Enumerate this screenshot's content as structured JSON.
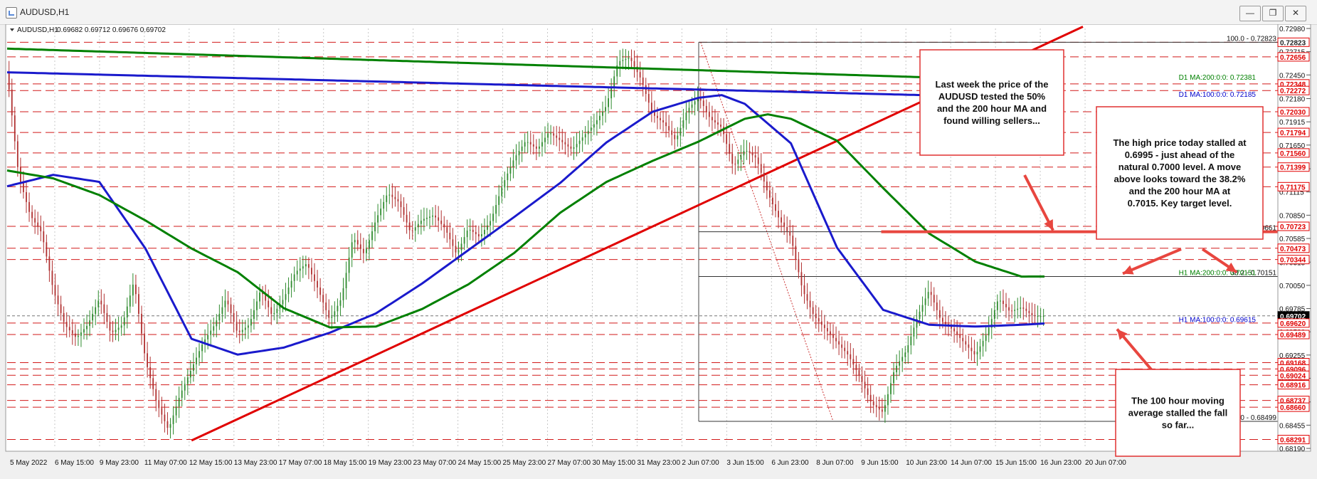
{
  "window": {
    "title": "AUDUSD,H1",
    "minimize": "—",
    "restore": "❐",
    "close": "✕"
  },
  "header": {
    "symbol": "AUDUSD,H1",
    "ohlc": "0.69682 0.69712 0.69676 0.69702"
  },
  "chart_data": {
    "type": "line",
    "symbol": "AUDUSD",
    "timeframe": "H1",
    "x_ticks": [
      "5 May 2022",
      "6 May 15:00",
      "9 May 23:00",
      "11 May 07:00",
      "12 May 15:00",
      "13 May 23:00",
      "17 May 07:00",
      "18 May 15:00",
      "19 May 23:00",
      "23 May 07:00",
      "24 May 15:00",
      "25 May 23:00",
      "27 May 07:00",
      "30 May 15:00",
      "31 May 23:00",
      "2 Jun 07:00",
      "3 Jun 15:00",
      "6 Jun 23:00",
      "8 Jun 07:00",
      "9 Jun 15:00",
      "10 Jun 23:00",
      "14 Jun 07:00",
      "15 Jun 15:00",
      "16 Jun 23:00",
      "20 Jun 07:00"
    ],
    "ylim": [
      0.6819,
      0.7298
    ],
    "y_ticks": [
      "0.72980",
      "0.72715",
      "0.72450",
      "0.72180",
      "0.71915",
      "0.71650",
      "0.71380",
      "0.71115",
      "0.70850",
      "0.70585",
      "0.70315",
      "0.70050",
      "0.69785",
      "0.69520",
      "0.69255",
      "0.68990",
      "0.68720",
      "0.68455",
      "0.68190"
    ],
    "price_tags": [
      {
        "value": 0.72823,
        "label": "0.72823",
        "color": "#ffffff",
        "text_color": "#222222"
      },
      {
        "value": 0.72656,
        "label": "0.72656",
        "color": "#ffffff",
        "text_color": "#e00000"
      },
      {
        "value": 0.72348,
        "label": "0.72348",
        "color": "#ffffff",
        "text_color": "#e00000"
      },
      {
        "value": 0.72272,
        "label": "0.72272",
        "color": "#ffffff",
        "text_color": "#e00000"
      },
      {
        "value": 0.7203,
        "label": "0.72030",
        "color": "#ffffff",
        "text_color": "#e00000"
      },
      {
        "value": 0.71794,
        "label": "0.71794",
        "color": "#ffffff",
        "text_color": "#e00000"
      },
      {
        "value": 0.7156,
        "label": "0.71560",
        "color": "#ffffff",
        "text_color": "#e00000"
      },
      {
        "value": 0.71399,
        "label": "0.71399",
        "color": "#ffffff",
        "text_color": "#e00000"
      },
      {
        "value": 0.71175,
        "label": "0.71175",
        "color": "#ffffff",
        "text_color": "#e00000"
      },
      {
        "value": 0.70723,
        "label": "0.70723",
        "color": "#ffffff",
        "text_color": "#e00000"
      },
      {
        "value": 0.70473,
        "label": "0.70473",
        "color": "#ffffff",
        "text_color": "#e00000"
      },
      {
        "value": 0.70344,
        "label": "0.70344",
        "color": "#ffffff",
        "text_color": "#e00000"
      },
      {
        "value": 0.69702,
        "label": "0.69702",
        "color": "#000000",
        "text_color": "#ffffff"
      },
      {
        "value": 0.6962,
        "label": "0.69620",
        "color": "#ffffff",
        "text_color": "#e00000"
      },
      {
        "value": 0.69489,
        "label": "0.69489",
        "color": "#ffffff",
        "text_color": "#e00000"
      },
      {
        "value": 0.69168,
        "label": "0.69168",
        "color": "#ffffff",
        "text_color": "#e00000"
      },
      {
        "value": 0.69096,
        "label": "0.69096",
        "color": "#ffffff",
        "text_color": "#e00000"
      },
      {
        "value": 0.69024,
        "label": "0.69024",
        "color": "#ffffff",
        "text_color": "#e00000"
      },
      {
        "value": 0.68916,
        "label": "0.68916",
        "color": "#ffffff",
        "text_color": "#e00000"
      },
      {
        "value": 0.68737,
        "label": "0.68737",
        "color": "#ffffff",
        "text_color": "#e00000"
      },
      {
        "value": 0.6866,
        "label": "0.68660",
        "color": "#ffffff",
        "text_color": "#e00000"
      },
      {
        "value": 0.68291,
        "label": "0.68291",
        "color": "#ffffff",
        "text_color": "#e00000"
      }
    ],
    "fib_levels": [
      {
        "value": 0.72823,
        "label": "100.0 - 0.72823"
      },
      {
        "value": 0.70661,
        "label": "50.0 - 0.70661"
      },
      {
        "value": 0.70151,
        "label": "38.2 - 0.70151"
      },
      {
        "value": 0.68499,
        "label": "0.0 - 0.68499"
      }
    ],
    "ma_labels": [
      {
        "text": "D1 MA:200:0:0: 0.72381",
        "value": 0.72381,
        "color": "#008000"
      },
      {
        "text": "D1 MA:100:0:0: 0.72185",
        "value": 0.72185,
        "color": "#0000cc"
      },
      {
        "text": "H1 MA:200:0:0: 0.70151",
        "value": 0.70151,
        "color": "#008000"
      },
      {
        "text": "H1 MA:100:0:0: 0.69615",
        "value": 0.69615,
        "color": "#0000cc"
      }
    ],
    "series": [
      {
        "name": "H1 MA:100",
        "color": "#1a1acc",
        "x": [
          0,
          24,
          48,
          72,
          96,
          120,
          144,
          168,
          192,
          216,
          240,
          264,
          288,
          312,
          336,
          360,
          372,
          384,
          408,
          432,
          456,
          480,
          504,
          528,
          540
        ],
        "y": [
          0.7118,
          0.7131,
          0.7123,
          0.7047,
          0.6944,
          0.6926,
          0.6934,
          0.6951,
          0.6973,
          0.7007,
          0.7045,
          0.7083,
          0.7122,
          0.7168,
          0.7203,
          0.7219,
          0.7222,
          0.7212,
          0.7167,
          0.7048,
          0.6977,
          0.696,
          0.6958,
          0.696,
          0.69615
        ]
      },
      {
        "name": "H1 MA:200",
        "color": "#008000",
        "x": [
          0,
          24,
          48,
          72,
          96,
          120,
          144,
          168,
          192,
          216,
          240,
          264,
          288,
          312,
          336,
          360,
          384,
          396,
          408,
          432,
          456,
          480,
          504,
          528,
          540
        ],
        "y": [
          0.7136,
          0.7127,
          0.7108,
          0.7079,
          0.7047,
          0.702,
          0.6979,
          0.6957,
          0.6958,
          0.6978,
          0.7006,
          0.7042,
          0.7088,
          0.7123,
          0.7147,
          0.7169,
          0.7195,
          0.72,
          0.7195,
          0.717,
          0.7116,
          0.7064,
          0.7032,
          0.7015,
          0.70151
        ]
      },
      {
        "name": "D1 MA:200",
        "color": "#008000",
        "x": [
          0,
          540
        ],
        "y": [
          0.7275,
          0.72381
        ]
      },
      {
        "name": "D1 MA:100",
        "color": "#1a1acc",
        "x": [
          0,
          540
        ],
        "y": [
          0.7248,
          0.72185
        ]
      }
    ],
    "trendline": {
      "color": "#e00000",
      "x": [
        96,
        560
      ],
      "y": [
        0.6828,
        0.73
      ]
    },
    "price": {
      "x": [
        0,
        6,
        12,
        18,
        24,
        30,
        36,
        42,
        48,
        54,
        60,
        66,
        72,
        78,
        84,
        90,
        96,
        102,
        108,
        114,
        120,
        126,
        132,
        138,
        144,
        150,
        156,
        162,
        168,
        174,
        180,
        186,
        192,
        198,
        204,
        210,
        216,
        222,
        228,
        234,
        240,
        246,
        252,
        258,
        264,
        270,
        276,
        282,
        288,
        294,
        300,
        306,
        312,
        318,
        324,
        330,
        336,
        342,
        348,
        354,
        360,
        366,
        372,
        378,
        384,
        390,
        396,
        402,
        408,
        414,
        420,
        426,
        432,
        438,
        444,
        450,
        456,
        462,
        468,
        474,
        480,
        486,
        492,
        498,
        504,
        510,
        516,
        522,
        528,
        534,
        540
      ],
      "y": [
        0.7248,
        0.713,
        0.7085,
        0.7065,
        0.7,
        0.696,
        0.6945,
        0.696,
        0.699,
        0.695,
        0.696,
        0.701,
        0.692,
        0.687,
        0.684,
        0.688,
        0.691,
        0.694,
        0.696,
        0.699,
        0.695,
        0.696,
        0.7,
        0.697,
        0.699,
        0.702,
        0.703,
        0.7,
        0.6965,
        0.699,
        0.706,
        0.704,
        0.708,
        0.711,
        0.71,
        0.7065,
        0.708,
        0.7085,
        0.707,
        0.704,
        0.707,
        0.706,
        0.708,
        0.712,
        0.715,
        0.717,
        0.716,
        0.718,
        0.717,
        0.716,
        0.7175,
        0.719,
        0.721,
        0.726,
        0.7265,
        0.724,
        0.72,
        0.719,
        0.717,
        0.7205,
        0.722,
        0.7195,
        0.7185,
        0.714,
        0.716,
        0.715,
        0.711,
        0.708,
        0.706,
        0.7,
        0.697,
        0.6955,
        0.694,
        0.6925,
        0.69,
        0.687,
        0.686,
        0.691,
        0.693,
        0.697,
        0.7,
        0.6965,
        0.6955,
        0.694,
        0.6925,
        0.695,
        0.699,
        0.6975,
        0.698,
        0.697,
        0.697
      ]
    },
    "annotations": [
      {
        "lines": [
          "Last week the price of the",
          "AUDUSD tested the 50%",
          "and the 200 hour MA and",
          "found willing sellers..."
        ]
      },
      {
        "lines": [
          "The high price today stalled at",
          "0.6995 - just ahead of the",
          "natural 0.7000 level.  A move",
          "above looks toward the 38.2%",
          "and the 200 hour MA at",
          "0.7015. Key target level."
        ]
      },
      {
        "lines": [
          "The 100 hour moving",
          "average stalled the fall",
          "so far..."
        ]
      }
    ]
  }
}
